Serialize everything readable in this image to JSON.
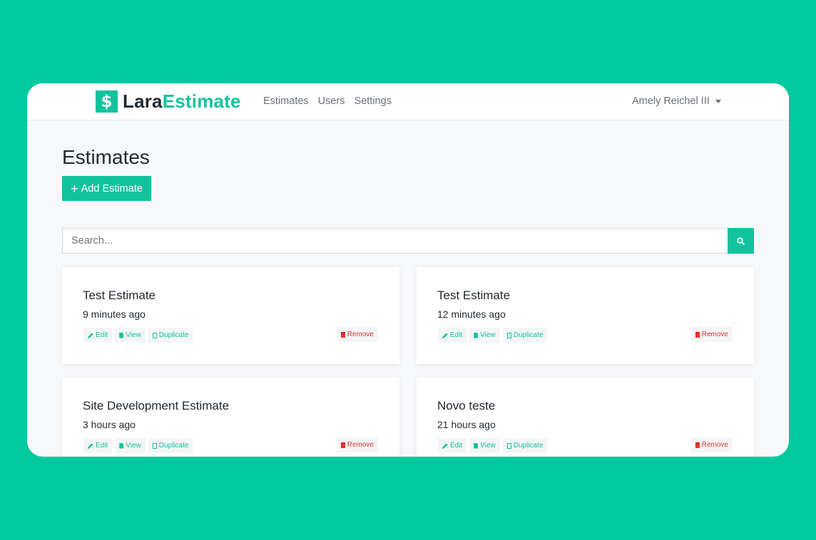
{
  "brand": {
    "logo_symbol": "$",
    "name_part1": "Lara",
    "name_part2": "Estimate"
  },
  "nav": {
    "links": [
      {
        "label": "Estimates"
      },
      {
        "label": "Users"
      },
      {
        "label": "Settings"
      }
    ],
    "user_name": "Amely Reichel III"
  },
  "page": {
    "title": "Estimates",
    "add_button": {
      "icon": "+",
      "label": "Add Estimate"
    }
  },
  "search": {
    "placeholder": "Search...",
    "value": "",
    "button_icon": "search-icon"
  },
  "actions": {
    "edit": "Edit",
    "view": "View",
    "duplicate": "Duplicate",
    "remove": "Remove"
  },
  "estimates": [
    {
      "title": "Test Estimate",
      "time": "9 minutes ago"
    },
    {
      "title": "Test Estimate",
      "time": "12 minutes ago"
    },
    {
      "title": "Site Development Estimate",
      "time": "3 hours ago"
    },
    {
      "title": "Novo teste",
      "time": "21 hours ago"
    }
  ],
  "colors": {
    "background": "#00c9a0",
    "accent": "#11c39d",
    "danger": "#e3342f",
    "text": "#222a30"
  }
}
